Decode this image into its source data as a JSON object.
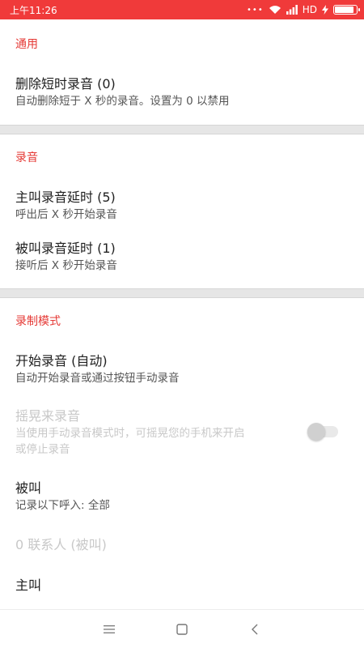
{
  "status_bar": {
    "time": "上午11:26",
    "dots": "•••",
    "network": "HD",
    "battery_level": 0.9
  },
  "sections": {
    "general": {
      "header": "通用",
      "delete_short": {
        "title": "删除短时录音 (0)",
        "subtitle": "自动删除短于 X 秒的录音。设置为 0 以禁用"
      }
    },
    "recording": {
      "header": "录音",
      "outgoing_delay": {
        "title": "主叫录音延时 (5)",
        "subtitle": "呼出后 X 秒开始录音"
      },
      "incoming_delay": {
        "title": "被叫录音延时 (1)",
        "subtitle": "接听后 X 秒开始录音"
      }
    },
    "mode": {
      "header": "录制模式",
      "start_recording": {
        "title": "开始录音 (自动)",
        "subtitle": "自动开始录音或通过按钮手动录音"
      },
      "shake_record": {
        "title": "摇晃来录音",
        "subtitle_line1": "当使用手动录音模式时，可摇晃您的手机来开启",
        "subtitle_line2": "或停止录音",
        "enabled": false
      },
      "incoming": {
        "title": "被叫",
        "subtitle": "记录以下呼入: 全部"
      },
      "contacts_incoming": {
        "title": "0 联系人 (被叫)"
      },
      "outgoing": {
        "title": "主叫"
      }
    }
  },
  "colors": {
    "accent": "#e53935",
    "status_bar": "#f03a3a",
    "divider": "#e6e6e6"
  }
}
